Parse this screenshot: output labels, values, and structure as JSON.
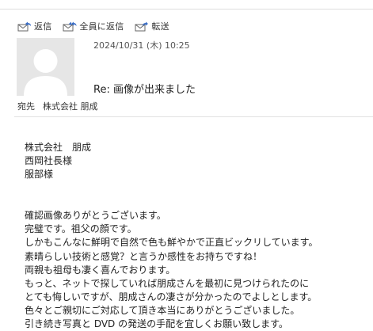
{
  "toolbar": {
    "reply_label": "返信",
    "reply_all_label": "全員に返信",
    "forward_label": "転送"
  },
  "message": {
    "date": "2024/10/31 (木) 10:25",
    "subject": "Re: 画像が出来ました",
    "to_label": "宛先",
    "to_value": "株式会社 朋成"
  },
  "body": {
    "greeting": [
      "株式会社　朋成",
      "西岡社長様",
      "服部様"
    ],
    "paragraph": [
      "確認画像ありがとうございます。",
      "完璧です。祖父の顔です。",
      "しかもこんなに鮮明で自然で色も鮮やかで正直ビックリしています。",
      "素晴らしい技術と感覚？と言うか感性をお持ちですね！",
      "両親も祖母も凄く喜んでおります。",
      "もっと、ネットで探していれば朋成さんを最初に見つけられたのに",
      "とても悔しいですが、朋成さんの凄さが分かったのでよしとします。",
      "色々とご親切にご対応して頂き本当にありがとうございました。",
      "引き続き写真と DVD の発送の手配を宜しくお願い致します。"
    ]
  }
}
